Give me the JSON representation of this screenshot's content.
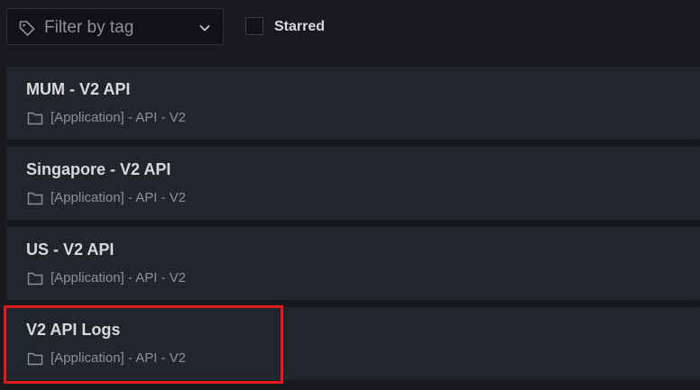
{
  "filter": {
    "placeholder": "Filter by tag",
    "icon": "tag-icon",
    "dropdown_icon": "chevron-down-icon"
  },
  "starred": {
    "label": "Starred",
    "checked": false
  },
  "dashboards": [
    {
      "title": "MUM - V2 API",
      "folder": "[Application] - API - V2"
    },
    {
      "title": "Singapore - V2 API",
      "folder": "[Application] - API - V2"
    },
    {
      "title": "US - V2 API",
      "folder": "[Application] - API - V2"
    },
    {
      "title": "V2 API Logs",
      "folder": "[Application] - API - V2",
      "highlighted": true
    }
  ],
  "colors": {
    "background": "#18191d",
    "card": "#22252b",
    "text_primary": "#d8d9de",
    "text_secondary": "#8e9099",
    "highlight": "#e31b1b"
  }
}
